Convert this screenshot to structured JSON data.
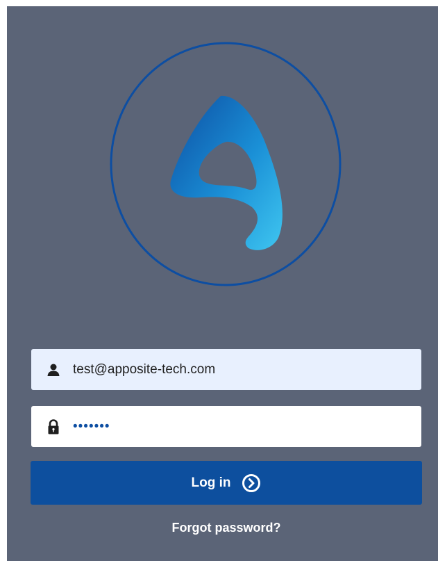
{
  "brand": {
    "logo_icon": "apposite-logo-icon",
    "ring_color": "#0d4ea2",
    "gradient_colors": [
      "#0d4ea2",
      "#1a8fd6",
      "#3fc6f0"
    ]
  },
  "form": {
    "username": {
      "value": "test@apposite-tech.com",
      "icon": "user-icon"
    },
    "password": {
      "value": "•••••••",
      "icon": "lock-icon"
    },
    "login_button": {
      "label": "Log in",
      "icon": "chevron-right-circle-icon"
    },
    "forgot_password": "Forgot password?"
  },
  "colors": {
    "panel_background": "#5b6477",
    "button_background": "#0d4f9e",
    "autofill_background": "#e8f0fe"
  }
}
